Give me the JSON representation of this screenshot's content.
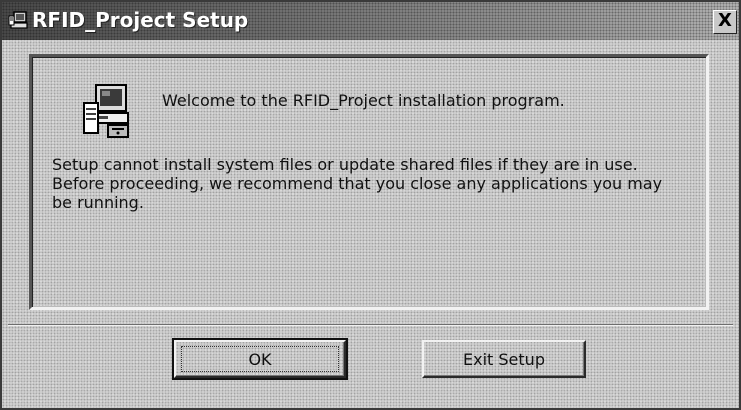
{
  "window": {
    "title": "RFID_Project Setup",
    "close_glyph": "X"
  },
  "panel": {
    "welcome": "Welcome to the RFID_Project installation program.",
    "message_lines": [
      "Setup cannot install system files or update shared files if they are in use.",
      "Before proceeding, we recommend that you close any applications you may",
      "be running."
    ]
  },
  "buttons": {
    "ok_label": "OK",
    "exit_label": "Exit Setup"
  },
  "icons": {
    "title": "setup-computer-icon",
    "welcome": "computer-install-icon",
    "close": "close-icon"
  }
}
